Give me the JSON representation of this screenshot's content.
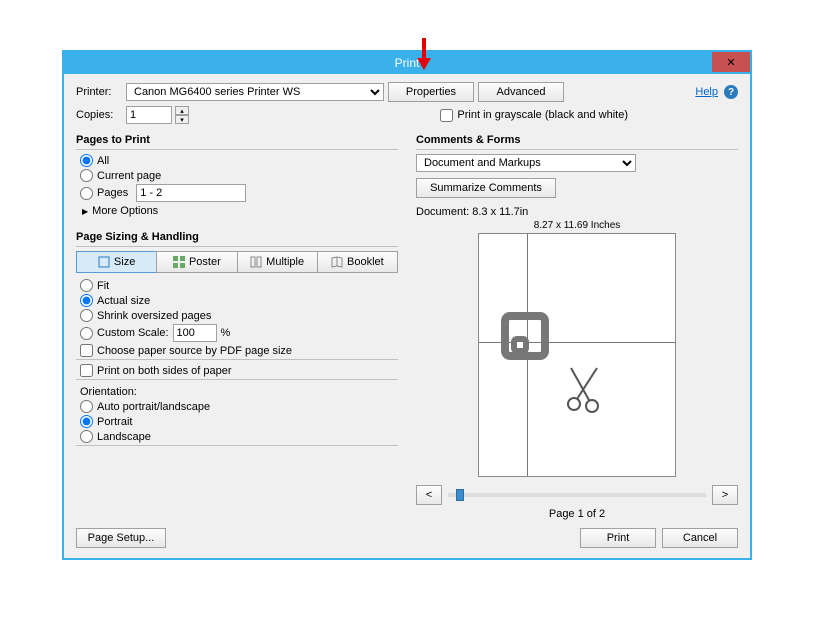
{
  "title": "Print",
  "close": "✕",
  "printer_label": "Printer:",
  "printer_selected": "Canon MG6400 series Printer WS",
  "properties_btn": "Properties",
  "advanced_btn": "Advanced",
  "help_label": "Help",
  "copies_label": "Copies:",
  "copies_value": "1",
  "grayscale_label": "Print in grayscale (black and white)",
  "pages_to_print": {
    "title": "Pages to Print",
    "all": "All",
    "current": "Current page",
    "pages": "Pages",
    "pages_value": "1 - 2",
    "more": "More Options"
  },
  "sizing": {
    "title": "Page Sizing & Handling",
    "size": "Size",
    "poster": "Poster",
    "multiple": "Multiple",
    "booklet": "Booklet",
    "fit": "Fit",
    "actual": "Actual size",
    "shrink": "Shrink oversized pages",
    "custom": "Custom Scale:",
    "custom_value": "100",
    "percent": "%",
    "choose_paper": "Choose paper source by PDF page size",
    "both_sides": "Print on both sides of paper",
    "orientation": "Orientation:",
    "auto": "Auto portrait/landscape",
    "portrait": "Portrait",
    "landscape": "Landscape"
  },
  "comments": {
    "title": "Comments & Forms",
    "selected": "Document and Markups",
    "summarize": "Summarize Comments"
  },
  "doc_dim": "Document: 8.3 x 11.7in",
  "preview_dim": "8.27 x 11.69 Inches",
  "nav_prev": "<",
  "nav_next": ">",
  "page_of": "Page 1 of 2",
  "page_setup": "Page Setup...",
  "print_btn": "Print",
  "cancel_btn": "Cancel"
}
